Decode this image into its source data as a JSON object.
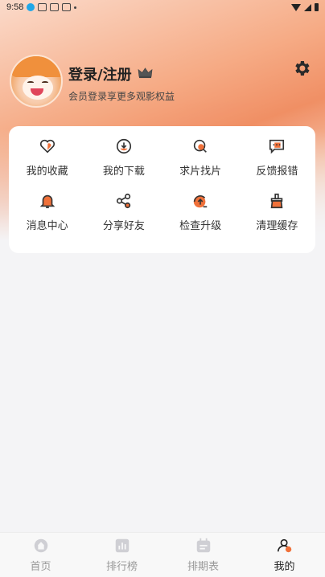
{
  "status_bar": {
    "time": "9:58"
  },
  "profile": {
    "title": "登录/注册",
    "subtitle": "会员登录享更多观影权益"
  },
  "menu": {
    "items": [
      {
        "label": "我的收藏",
        "icon": "heart-icon"
      },
      {
        "label": "我的下载",
        "icon": "download-icon"
      },
      {
        "label": "求片找片",
        "icon": "search-film-icon"
      },
      {
        "label": "反馈报错",
        "icon": "feedback-icon"
      },
      {
        "label": "消息中心",
        "icon": "bell-icon"
      },
      {
        "label": "分享好友",
        "icon": "share-icon"
      },
      {
        "label": "检查升级",
        "icon": "upgrade-icon"
      },
      {
        "label": "清理缓存",
        "icon": "broom-icon"
      }
    ]
  },
  "bottom_nav": {
    "items": [
      {
        "label": "首页",
        "icon": "home-icon",
        "active": false
      },
      {
        "label": "排行榜",
        "icon": "ranking-icon",
        "active": false
      },
      {
        "label": "排期表",
        "icon": "calendar-icon",
        "active": false
      },
      {
        "label": "我的",
        "icon": "profile-icon",
        "active": true
      }
    ]
  },
  "colors": {
    "accent": "#f0713a",
    "icon_dark": "#333333",
    "inactive": "#999999"
  }
}
